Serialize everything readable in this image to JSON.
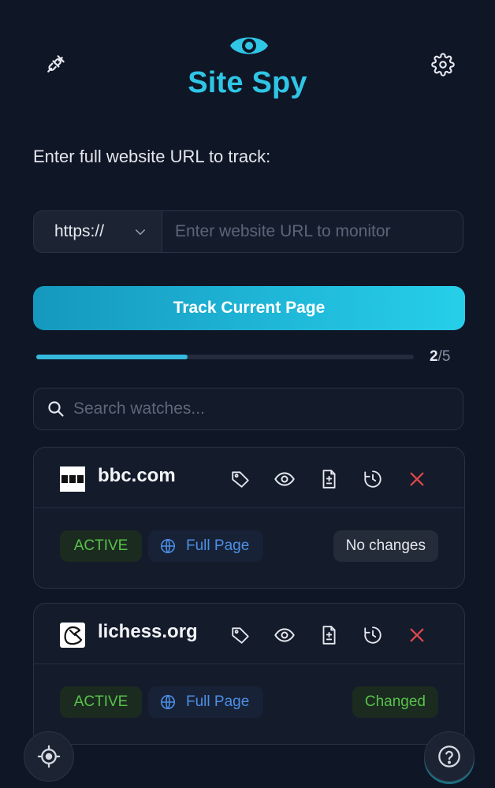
{
  "header": {
    "title": "Site Spy",
    "left_icon": "plug-icon",
    "right_icon": "gear-icon",
    "logo_icon": "eye-icon",
    "brand_color": "#2fc6e6"
  },
  "url_form": {
    "prompt": "Enter full website URL to track:",
    "protocol": "https://",
    "placeholder": "Enter website URL to monitor",
    "track_button": "Track Current Page"
  },
  "usage": {
    "current": "2",
    "separator": "/",
    "max": "5",
    "fraction": 0.4
  },
  "search": {
    "placeholder": "Search watches..."
  },
  "watches": [
    {
      "site": "bbc.com",
      "favicon": "bbc-favicon",
      "state": "ACTIVE",
      "mode": "Full Page",
      "status": "No changes"
    },
    {
      "site": "lichess.org",
      "favicon": "lichess-favicon",
      "state": "ACTIVE",
      "mode": "Full Page",
      "status": "Changed"
    }
  ],
  "card_actions": [
    "tag-icon",
    "eye-icon",
    "diff-document-icon",
    "history-icon",
    "close-icon"
  ],
  "colors": {
    "background": "#0f1626",
    "accent": "#2fc6e6",
    "active_green": "#58c24a",
    "delete_red": "#e0484a",
    "mode_blue": "#4d8fe6"
  },
  "floating": {
    "left": "crosshair-icon",
    "right": "help-icon"
  }
}
